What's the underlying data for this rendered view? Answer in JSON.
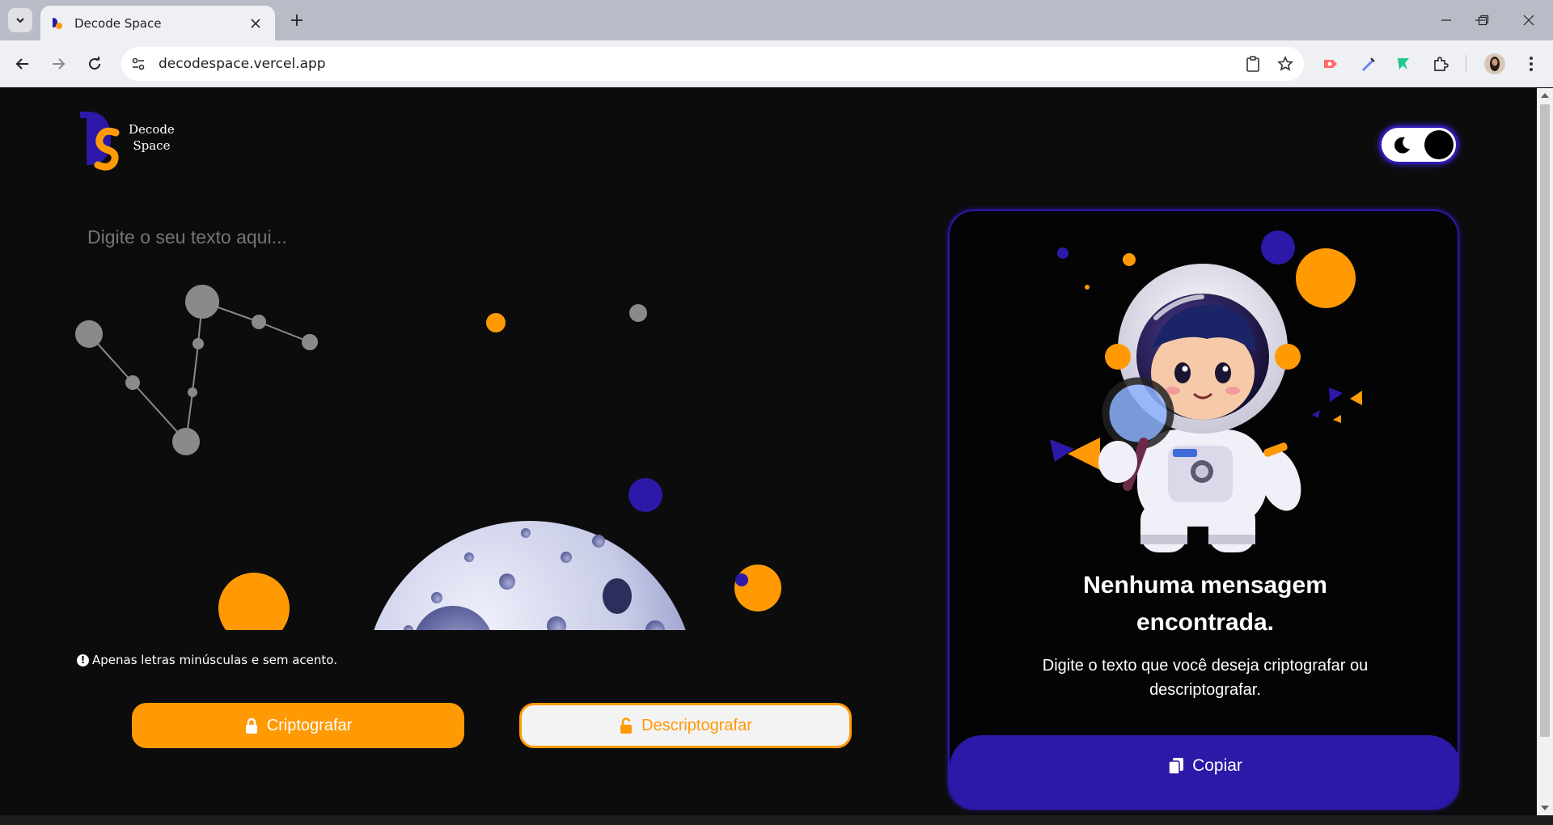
{
  "browser": {
    "tab_title": "Decode Space",
    "url": "decodespace.vercel.app"
  },
  "site": {
    "logo_line1": "Decode",
    "logo_line2": "Space",
    "colors": {
      "accent": "#ff9a05",
      "primary": "#2c19a8",
      "background": "#0c0c0d"
    }
  },
  "input": {
    "placeholder": "Digite o seu texto aqui..."
  },
  "hint": "Apenas letras minúsculas e sem acento.",
  "buttons": {
    "encrypt": "Criptografar",
    "decrypt": "Descriptografar"
  },
  "output": {
    "heading": "Nenhuma mensagem encontrada.",
    "subtext": "Digite o texto que você deseja criptografar ou descriptografar.",
    "copy": "Copiar"
  }
}
